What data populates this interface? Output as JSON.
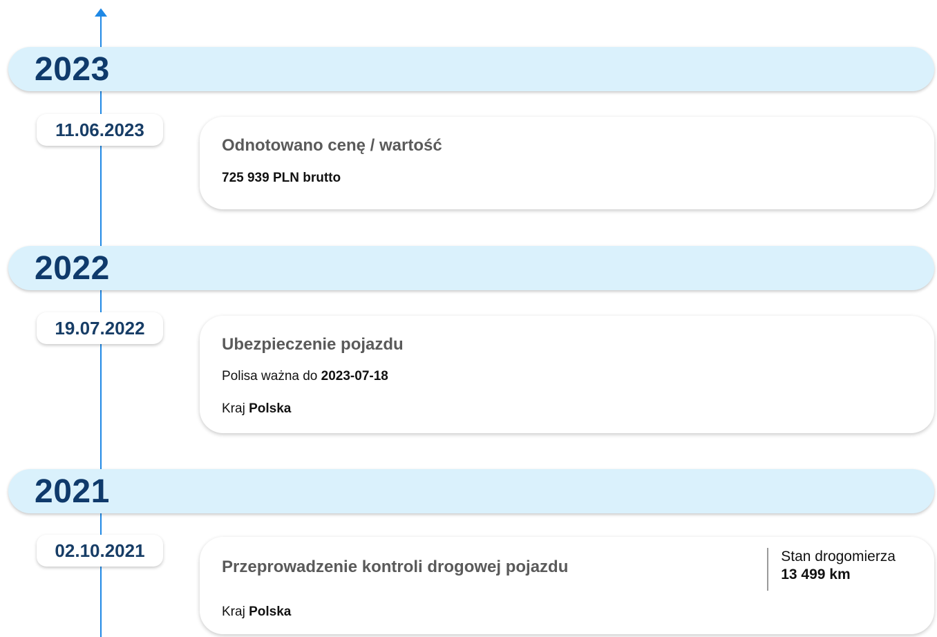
{
  "timeline": {
    "years": [
      {
        "year": "2023",
        "events": [
          {
            "date": "11.06.2023",
            "title": "Odnotowano cenę / wartość",
            "value": "725 939 PLN brutto"
          }
        ]
      },
      {
        "year": "2022",
        "events": [
          {
            "date": "19.07.2022",
            "title": "Ubezpieczenie pojazdu",
            "policy_label": "Polisa ważna do",
            "policy_value": "2023-07-18",
            "country_label": "Kraj",
            "country_value": "Polska"
          }
        ]
      },
      {
        "year": "2021",
        "events": [
          {
            "date": "02.10.2021",
            "title": "Przeprowadzenie kontroli drogowej pojazdu",
            "odometer_label": "Stan drogomierza",
            "odometer_value": "13 499 km",
            "country_label": "Kraj",
            "country_value": "Polska"
          }
        ]
      }
    ]
  },
  "colors": {
    "axis": "#1e88e5",
    "year_band_bg": "#daf1fc",
    "year_text": "#0f3a6b",
    "date_text": "#173d66",
    "card_title": "#5a5a5a"
  },
  "icons": {
    "axis_arrow": "arrow-up-icon"
  }
}
